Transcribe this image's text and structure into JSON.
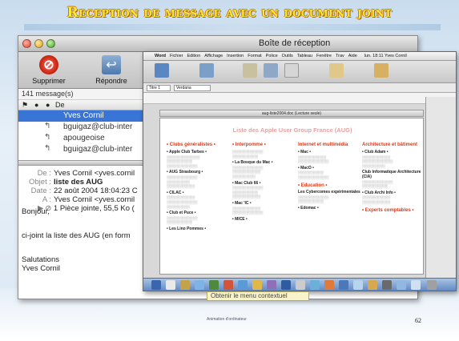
{
  "slide": {
    "title": "Reception de message avec un document joint",
    "page_number": "62",
    "footer_small": "Animation   d'ordinateur",
    "tooltip": "Obtenir le menu contextuel"
  },
  "mail": {
    "window_title": "Boîte de réception",
    "toolbar": {
      "delete_label": "Supprimer",
      "reply_label": "Répondre"
    },
    "message_count": "141 message(s)",
    "columns": {
      "from": "De"
    },
    "messages": [
      {
        "from": "Yves Cornil",
        "selected": true
      },
      {
        "from": "bguigaz@club-inter",
        "selected": false
      },
      {
        "from": "apougeoise",
        "selected": false
      },
      {
        "from": "bguigaz@club-inter",
        "selected": false
      }
    ],
    "headers": {
      "from_label": "De :",
      "from_value": "Yves Cornil <yves.cornil",
      "subject_label": "Objet :",
      "subject_value": "liste des AUG",
      "date_label": "Date :",
      "date_value": "22 août 2004 18:04:23 C",
      "to_label": "A :",
      "to_value": "Yves Cornil <yves.cornil",
      "attachment_value": "1 Pièce jointe, 55,5 Ko ("
    },
    "body": {
      "greeting": "Bonjour,",
      "line1": "ci-joint la liste des AUG (en form",
      "closing": "Salutations",
      "signature": "Yves Cornil"
    }
  },
  "word": {
    "menu": [
      "Word",
      "Fichier",
      "Edition",
      "Affichage",
      "Insertion",
      "Format",
      "Police",
      "Outils",
      "Tableau",
      "Fenêtre",
      "Trav",
      "Aide"
    ],
    "menu_right": "lun. 18:11   Yves Cornil",
    "font_name": "Verdana",
    "style_name": "Titre 1",
    "doc_title": "aug-liste2004.doc (Lecture seule)",
    "doc_heading": "Liste des Apple User Group France (AUG)",
    "columns": [
      {
        "heading": "• Clubs généralistes •",
        "items": [
          "• Apple Club Tarbes •",
          "• AUG Strasbourg •",
          "• CILAC •",
          "• Club et Puce •",
          "• Les Lino Pommes •"
        ]
      },
      {
        "heading": "• Interpomme •",
        "items": [
          "• La Bosque du Mac •",
          "• Mac Club 66 •",
          "• Mac 'IC •",
          "• MICE •"
        ]
      },
      {
        "heading": "Internet et multimédia",
        "items": [
          "• Mac •",
          "• MacO •",
          "• Education •",
          "Les Cybercomes expérimentales",
          "• Edomac •"
        ]
      },
      {
        "heading": "Architecture et bâtiment",
        "items": [
          "• Club Adam •",
          "Club Informatique Architecture (CIA)",
          "• Club Archi Info •",
          "• Experts comptables •"
        ]
      }
    ]
  },
  "colors": {
    "title_yellow": "#ffe83a",
    "selection_blue": "#3875d7",
    "doc_heading_red": "#d93b1a"
  }
}
